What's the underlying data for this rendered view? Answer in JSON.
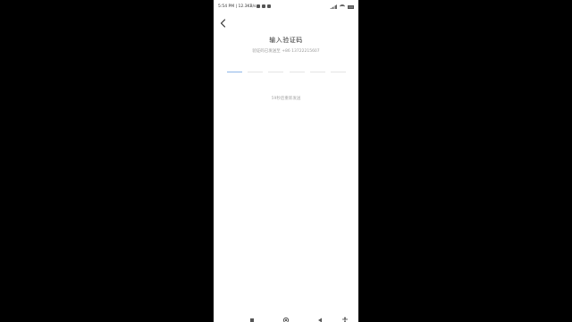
{
  "status_bar": {
    "time_speed": "5:54 PM | 12.3KB/s",
    "signal_icon": "signal-icon",
    "wifi_icon": "wifi-icon",
    "battery_icon": "battery-icon"
  },
  "header": {
    "back_icon": "chevron-left-icon"
  },
  "main": {
    "title": "输入验证码",
    "subtitle": "验证码已发送至 +86 13722215607",
    "code_slots": 6,
    "resend_text": "59秒后重新发送"
  },
  "nav_bar": {
    "items": [
      "menu-icon",
      "home-icon",
      "back-icon",
      "accessibility-icon"
    ]
  },
  "colors": {
    "background": "#000000",
    "screen": "#ffffff",
    "accent": "#8fb6e8",
    "text_primary": "#333333",
    "text_secondary": "#9a9a9a"
  }
}
